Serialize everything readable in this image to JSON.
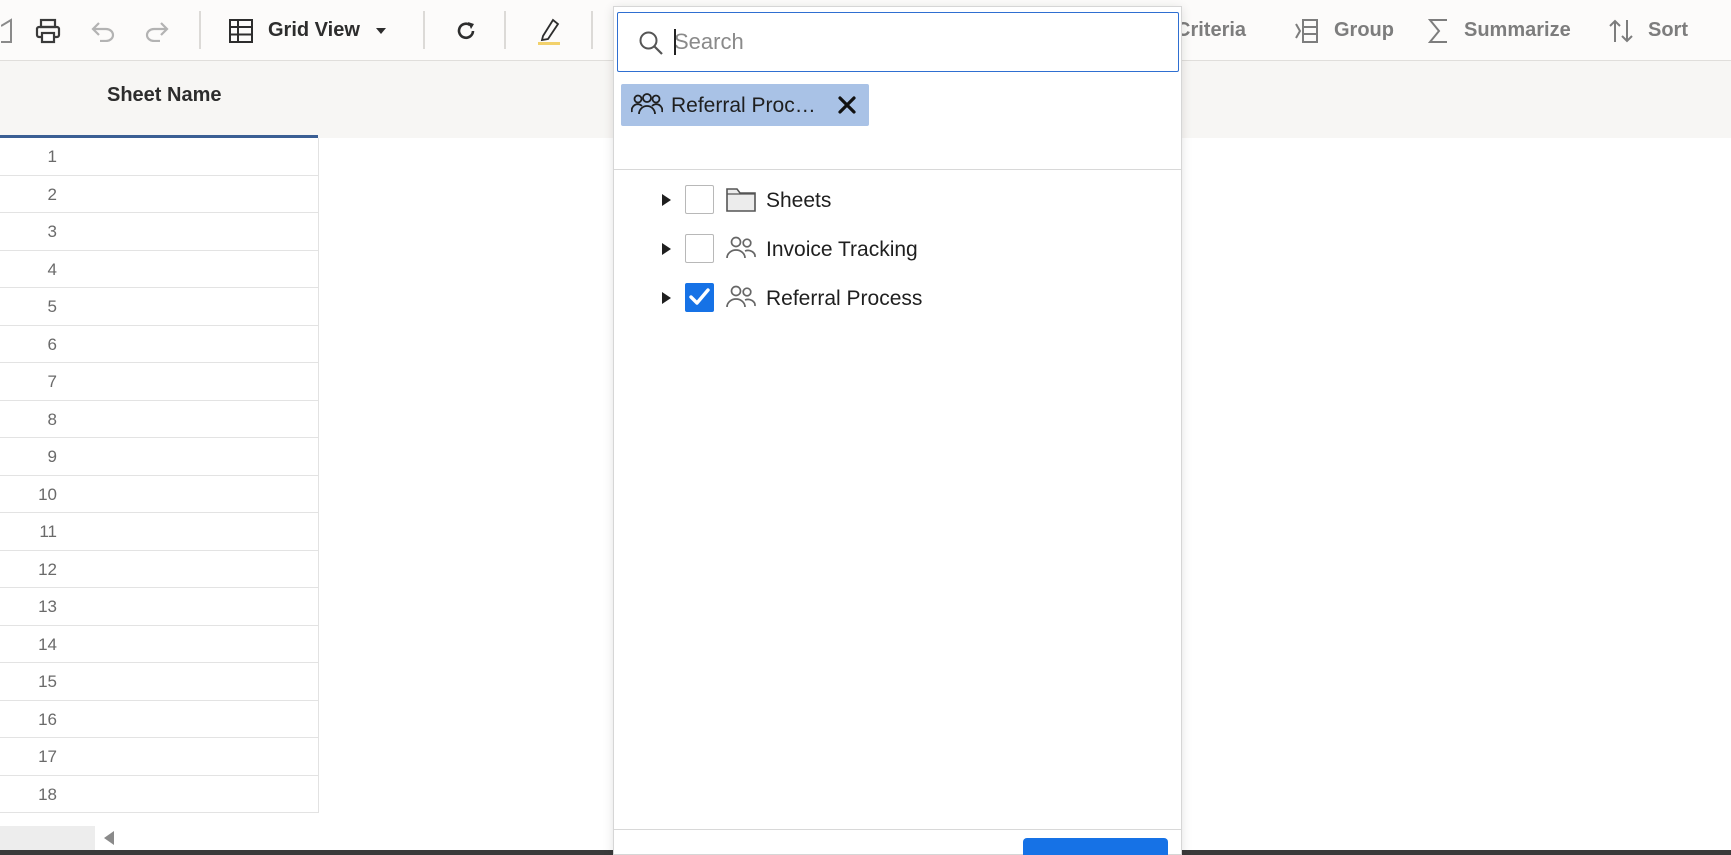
{
  "toolbar": {
    "view_label": "Grid View",
    "criteria_label": "Criteria",
    "group_label": "Group",
    "summarize_label": "Summarize",
    "sort_label": "Sort"
  },
  "sheet_list": {
    "column_header": "Sheet Name",
    "row_numbers": [
      "1",
      "2",
      "3",
      "4",
      "5",
      "6",
      "7",
      "8",
      "9",
      "10",
      "11",
      "12",
      "13",
      "14",
      "15",
      "16",
      "17",
      "18"
    ]
  },
  "picker": {
    "search_placeholder": "Search",
    "selected_chip": "Referral Proc…",
    "tree": [
      {
        "label": "Sheets",
        "icon": "folder-icon",
        "checked": false
      },
      {
        "label": "Invoice Tracking",
        "icon": "workspace-people-icon",
        "checked": false
      },
      {
        "label": "Referral Process",
        "icon": "workspace-people-icon",
        "checked": true
      }
    ]
  },
  "colors": {
    "accent_blue": "#1672e6",
    "chip_bg": "#a9c2e6",
    "header_underline": "#3b5f94"
  }
}
